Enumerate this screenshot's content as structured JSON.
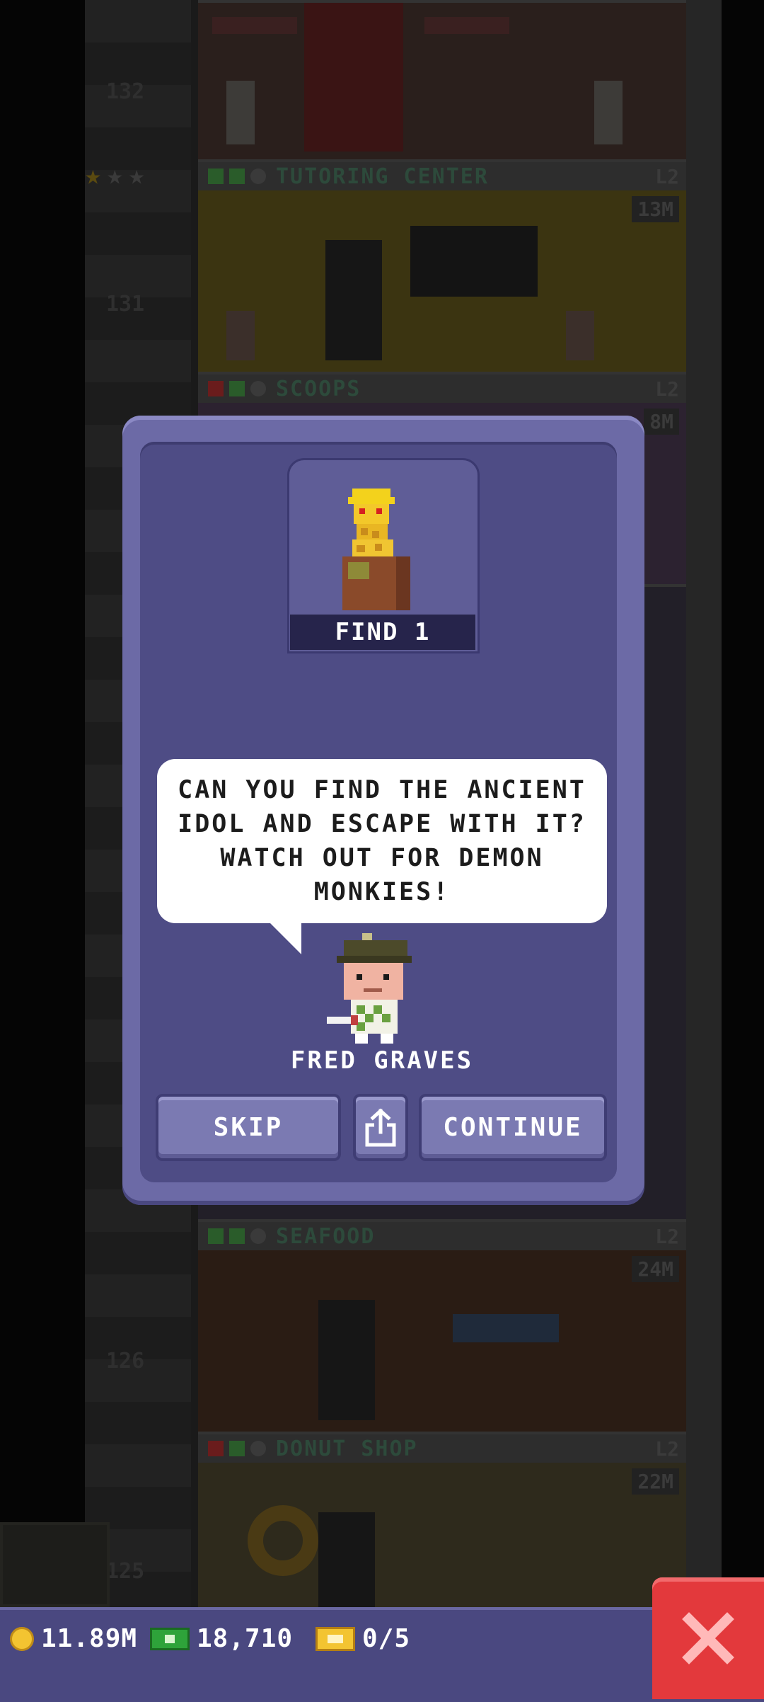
{
  "tower": {
    "floors": [
      {
        "name": "",
        "level": "",
        "number": "132",
        "value": ""
      },
      {
        "name": "TUTORING CENTER",
        "level": "L2",
        "number": "131",
        "value": "13M",
        "stars": 1
      },
      {
        "name": "SCOOPS",
        "level": "L2",
        "number": "",
        "value": "8M"
      },
      {
        "name": "SEAFOOD",
        "level": "L2",
        "number": "126",
        "value": "24M"
      },
      {
        "name": "DONUT SHOP",
        "level": "L2",
        "number": "125",
        "value": "22M"
      }
    ]
  },
  "mission_dialog": {
    "goal_label": "FIND 1",
    "message": "CAN YOU FIND THE ANCIENT IDOL AND ESCAPE WITH IT? WATCH OUT FOR DEMON MONKIES!",
    "npc_name": "FRED GRAVES",
    "skip_label": "SKIP",
    "share_icon": "share-icon",
    "continue_label": "CONTINUE"
  },
  "status_bar": {
    "coins": "11.89M",
    "bux": "18,710",
    "tickets": "0/5"
  },
  "close_icon": "close-icon"
}
